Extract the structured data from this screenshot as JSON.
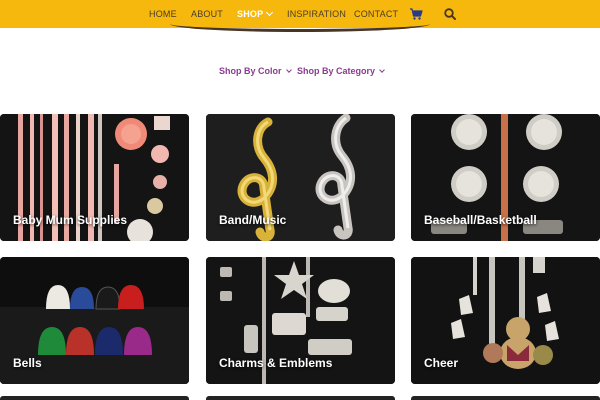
{
  "nav": {
    "items": [
      {
        "label": "HOME",
        "active": false
      },
      {
        "label": "ABOUT",
        "active": false
      },
      {
        "label": "SHOP",
        "active": true
      },
      {
        "label": "INSPIRATION",
        "active": false
      },
      {
        "label": "CONTACT",
        "active": false
      }
    ],
    "cart_icon": "cart-icon",
    "search_icon": "search-icon"
  },
  "filters": {
    "color_label": "Shop By Color",
    "category_label": "Shop By Category"
  },
  "categories": [
    {
      "label": "Baby Mum Supplies"
    },
    {
      "label": "Band/Music"
    },
    {
      "label": "Baseball/Basketball"
    },
    {
      "label": "Bells"
    },
    {
      "label": "Charms & Emblems"
    },
    {
      "label": "Cheer"
    }
  ],
  "colors": {
    "header": "#f7b80d",
    "nav_text": "#4a3c2a",
    "filter_text": "#8a3c8f",
    "card_label": "#ffffff"
  }
}
